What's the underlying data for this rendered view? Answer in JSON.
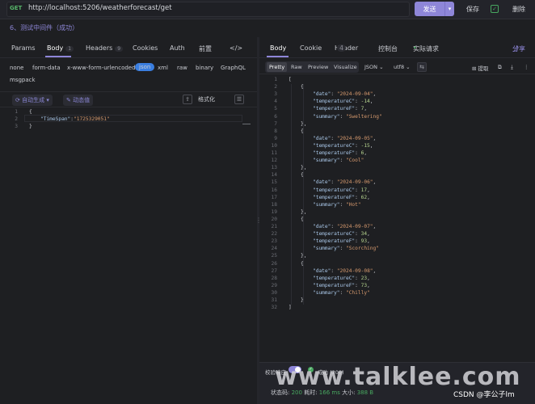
{
  "request": {
    "method": "GET",
    "url": "http://localhost:5206/weatherforecast/get",
    "send_label": "发送",
    "save_label": "保存",
    "delete_label": "删除"
  },
  "breadcrumb": "6、测试中间件（成功）",
  "left_tabs": {
    "params": "Params",
    "body": "Body",
    "body_count": "1",
    "headers": "Headers",
    "headers_count": "9",
    "cookies": "Cookies",
    "auth": "Auth",
    "pre": "前置",
    "more": "</>"
  },
  "body_types": {
    "none": "none",
    "form_data": "form-data",
    "urlencoded": "x-www-form-urlencoded",
    "json": "json",
    "xml": "xml",
    "raw": "raw",
    "binary": "binary",
    "graphql": "GraphQL",
    "msgpack": "msgpack"
  },
  "left_toolbar": {
    "auto_generate": "自动生成",
    "dynamic_value": "动态值",
    "format": "格式化"
  },
  "request_body_lines": [
    {
      "n": "1",
      "text": "{"
    },
    {
      "n": "2",
      "key": "\"TimeSpan\"",
      "val": "\"1725329051\""
    },
    {
      "n": "3",
      "text": "}"
    }
  ],
  "right_tabs": {
    "body": "Body",
    "cookie": "Cookie",
    "header": "Header",
    "header_count": "4",
    "console": "控制台",
    "actual_request": "实际请求",
    "share": "分享"
  },
  "response_toolbar": {
    "pretty": "Pretty",
    "raw": "Raw",
    "preview": "Preview",
    "visualize": "Visualize",
    "format": "JSON",
    "encoding": "utf8",
    "extract": "提取"
  },
  "response_items": [
    {
      "date": "\"2024-09-04\"",
      "c": "-14",
      "f": "7",
      "summary": "\"Sweltering\""
    },
    {
      "date": "\"2024-09-05\"",
      "c": "-15",
      "f": "6",
      "summary": "\"Cool\""
    },
    {
      "date": "\"2024-09-06\"",
      "c": "17",
      "f": "62",
      "summary": "\"Hot\""
    },
    {
      "date": "\"2024-09-07\"",
      "c": "34",
      "f": "93",
      "summary": "\"Scorching\""
    },
    {
      "date": "\"2024-09-08\"",
      "c": "23",
      "f": "73",
      "summary": "\"Chilly\""
    }
  ],
  "response_keys": {
    "date": "\"date\"",
    "c": "\"temperatureC\"",
    "f": "\"temperatureF\"",
    "summary": "\"summary\""
  },
  "status": {
    "validate_label": "校验响应",
    "result": "成功 (200)",
    "code_label": "状态码:",
    "code": "200",
    "time_label": "耗时:",
    "time": "166 ms",
    "size_label": "大小:",
    "size": "388 B"
  },
  "watermark": "www.talklee.com",
  "csdn_credit": "CSDN @李公子lm",
  "colors": {
    "accent": "#8e86d8",
    "json_chip": "#3a7ee0",
    "success": "#48a860"
  }
}
